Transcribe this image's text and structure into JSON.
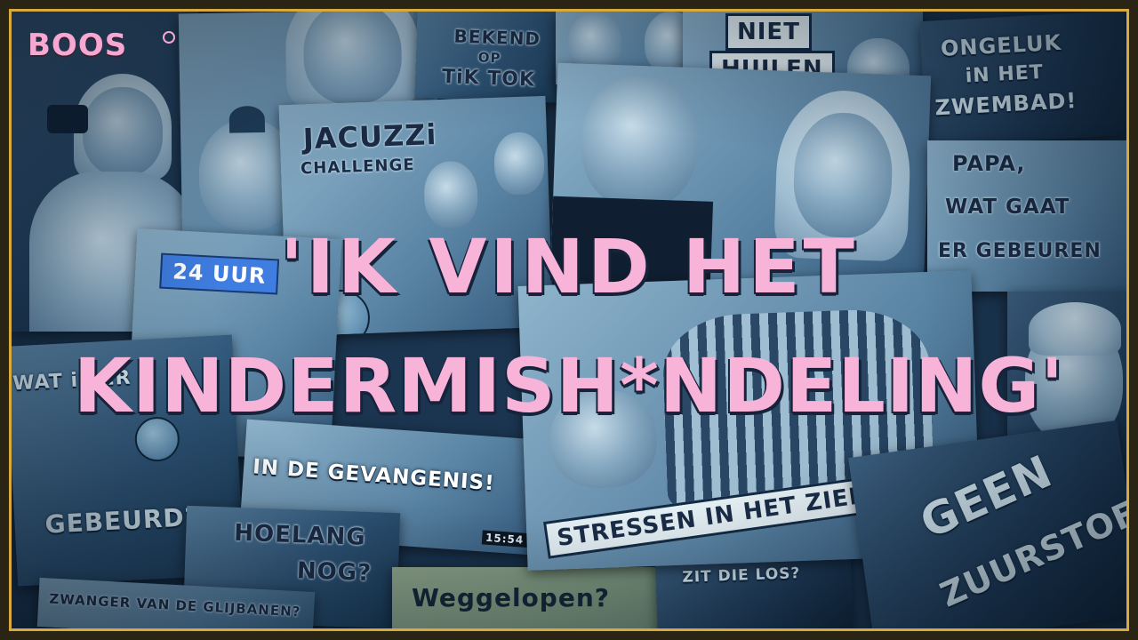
{
  "brand": {
    "logo": "BOOS"
  },
  "headline": {
    "line1": "'IK VIND HET",
    "line2": "KINDERMISH*NDELING'"
  },
  "tiles": {
    "bekend": {
      "line1": "BEKEND",
      "line2": "OP",
      "line3": "TiK TOK"
    },
    "niet_huilen": {
      "line1": "NIET",
      "line2": "HUILEN"
    },
    "ongeluk": {
      "line1": "ONGELUK",
      "line2": "iN HET",
      "line3": "ZWEMBAD!"
    },
    "jacuzzi": {
      "line1": "JACUZZi",
      "line2": "CHALLENGE"
    },
    "papa": {
      "line1": "PAPA,",
      "line2": "WAT GAAT",
      "line3": "ER GEBEUREN"
    },
    "uur": {
      "label": "24 UUR"
    },
    "wat_is_er": {
      "line1": "WAT iS ER",
      "line2": "GEBEURD?"
    },
    "gevangenis": {
      "label": "IN DE GEVANGENIS!",
      "duration": "15:54"
    },
    "stressen": {
      "label": "STRESSEN IN HET ZIEKENHUIS"
    },
    "geen": {
      "line1": "GEEN",
      "line2": "ZUURSTOF!"
    },
    "hoelang": {
      "line1": "HOELANG",
      "line2": "NOG?"
    },
    "zwanger": {
      "label": "ZWANGER VAN DE GLIJBANEN?"
    },
    "weggelopen": {
      "label": "Weggelopen?"
    },
    "zit_die_los": {
      "label": "ZIT DIE LOS?"
    }
  },
  "colors": {
    "frame": "#d8a93c",
    "headline": "#f7b3d8",
    "logo": "#f6a8d2",
    "tile_tint": "#2e5476"
  },
  "icons": {
    "scared_emoji": "scared-face-emoji-icon",
    "sick_emoji": "worried-face-emoji-icon",
    "logo_mark": "registered-mark-icon"
  }
}
